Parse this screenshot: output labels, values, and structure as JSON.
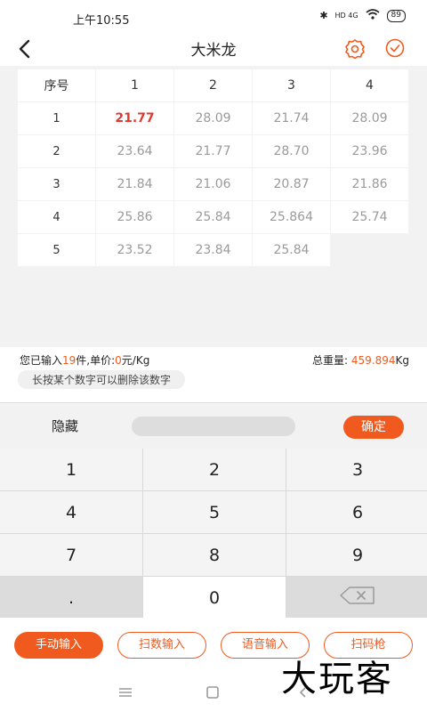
{
  "status": {
    "time": "上午10:55",
    "battery": "89",
    "network": "HD 4G"
  },
  "header": {
    "title": "大米龙"
  },
  "grid": {
    "header": [
      "序号",
      "1",
      "2",
      "3",
      "4"
    ],
    "rows": [
      {
        "index": "1",
        "values": [
          "21.77",
          "28.09",
          "21.74",
          "28.09"
        ]
      },
      {
        "index": "2",
        "values": [
          "23.64",
          "21.77",
          "28.70",
          "23.96"
        ]
      },
      {
        "index": "3",
        "values": [
          "21.84",
          "21.06",
          "20.87",
          "21.86"
        ]
      },
      {
        "index": "4",
        "values": [
          "25.86",
          "25.84",
          "25.864",
          "25.74"
        ]
      },
      {
        "index": "5",
        "values": [
          "23.52",
          "23.84",
          "25.84",
          ""
        ]
      }
    ],
    "highlight_color": "#e03a2f"
  },
  "info": {
    "prefix": "您已输入",
    "count": "19",
    "mid": "件,单价:",
    "price": "0",
    "unit": "元/Kg",
    "total_label": "总重量: ",
    "total_value": "459.894",
    "total_unit": "Kg",
    "hint": "长按某个数字可以删除该数字"
  },
  "keypad": {
    "hide_label": "隐藏",
    "confirm_label": "确定",
    "keys": [
      "1",
      "2",
      "3",
      "4",
      "5",
      "6",
      "7",
      "8",
      "9",
      ".",
      "0",
      "⌫"
    ]
  },
  "modes": {
    "manual": "手动输入",
    "scan_number": "扫数输入",
    "voice": "语音输入",
    "scanner": "扫码枪"
  },
  "watermark": "大玩客",
  "colors": {
    "accent": "#f05a1e"
  }
}
